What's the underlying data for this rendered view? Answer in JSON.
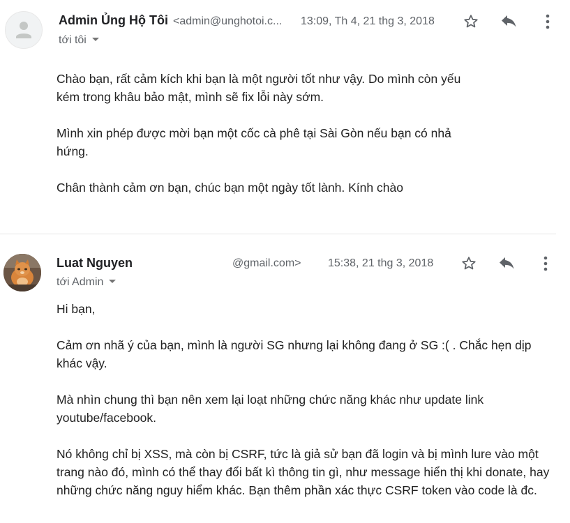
{
  "messages": [
    {
      "sender_name": "Admin Ủng Hộ Tôi",
      "sender_email": "<admin@unghotoi.c...",
      "timestamp": "13:09, Th 4, 21 thg 3, 2018",
      "recipient": "tới tôi",
      "paragraphs": [
        "Chào bạn, rất cảm kích khi bạn là một người tốt như vậy. Do mình còn yếu kém trong khâu bảo mật, mình sẽ fix lỗi này sớm.",
        "Mình xin phép được mời bạn một cốc cà phê tại Sài Gòn nếu bạn có nhả hứng.",
        "Chân thành cảm ơn bạn, chúc bạn một ngày tốt lành. Kính chào"
      ]
    },
    {
      "sender_name": "Luat Nguyen",
      "sender_email": "@gmail.com>",
      "timestamp": "15:38, 21 thg 3, 2018",
      "recipient": "tới Admin",
      "paragraphs": [
        "Hi bạn,",
        "Cảm ơn nhã ý của bạn, mình là người SG nhưng lại không đang ở SG :( . Chắc hẹn dịp khác vậy.",
        "Mà nhìn chung thì bạn nên xem lại loạt những chức năng khác như update link youtube/facebook.",
        "Nó không chỉ bị XSS, mà còn bị CSRF, tức là giả sử bạn đã login và bị mình lure vào một trang nào đó, mình có thể thay đổi bất kì thông tin gì, như message hiển thị khi donate, hay những chức năng nguy hiểm khác. Bạn thêm phần xác thực CSRF token vào code là đc."
      ]
    }
  ],
  "icons": {
    "star": "star-icon",
    "reply": "reply-icon",
    "more": "more-vert-icon"
  },
  "colors": {
    "icon": "#5f6368",
    "divider": "#e4e4e4",
    "text": "#222222",
    "meta": "#5f6368"
  }
}
